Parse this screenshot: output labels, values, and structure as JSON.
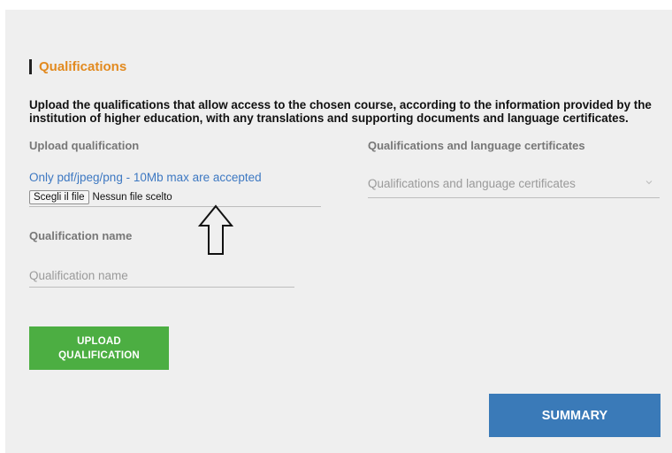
{
  "section": {
    "title": "Qualifications",
    "intro": "Upload the qualifications that allow access to the chosen course, according to the information provided by the institution of higher education, with any translations and supporting documents and language certificates."
  },
  "upload": {
    "label": "Upload qualification",
    "hint": "Only pdf/jpeg/png - 10Mb max are accepted",
    "file_button": "Scegli il file",
    "file_status": "Nessun file scelto"
  },
  "certificates": {
    "label": "Qualifications and language certificates",
    "selected": "Qualifications and language certificates"
  },
  "qualification_name": {
    "label": "Qualification name",
    "placeholder": "Qualification name"
  },
  "buttons": {
    "upload": "UPLOAD QUALIFICATION",
    "summary": "SUMMARY"
  },
  "colors": {
    "section_title": "#e28a1f",
    "hint": "#3d78c2",
    "upload_button": "#4cae42",
    "summary_button": "#3a7ab8",
    "panel_background": "#efefef"
  },
  "icons": {
    "annotation": "up-arrow-outline-icon",
    "select_indicator": "chevron-down-icon"
  }
}
